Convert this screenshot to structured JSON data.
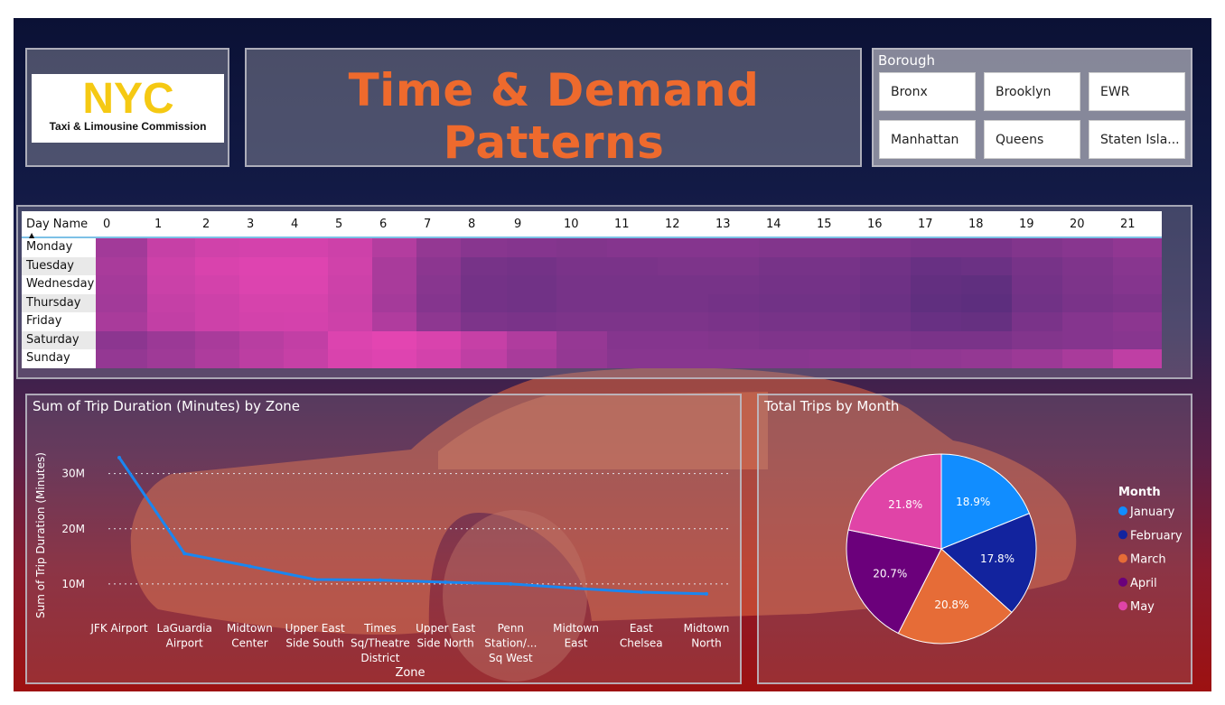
{
  "header": {
    "logo_mark": "NYC",
    "logo_text": "Taxi & Limousine Commission",
    "title": "Time & Demand Patterns"
  },
  "borough": {
    "title": "Borough",
    "options": [
      "Bronx",
      "Brooklyn",
      "EWR",
      "Manhattan",
      "Queens",
      "Staten Isla..."
    ]
  },
  "colors": {
    "title_orange": "#ee6a2d",
    "heat_low": "#5a2e7d",
    "heat_high": "#ea46b4",
    "line_blue": "#1a86f0",
    "january": "#118dff",
    "february": "#12239e",
    "march": "#e66c37",
    "april": "#6b007b",
    "may": "#e044a7"
  },
  "heatmap": {
    "row_header": "Day Name",
    "hours": [
      "0",
      "1",
      "2",
      "3",
      "4",
      "5",
      "6",
      "7",
      "8",
      "9",
      "10",
      "11",
      "12",
      "13",
      "14",
      "15",
      "16",
      "17",
      "18",
      "19",
      "20",
      "21"
    ],
    "days": [
      "Monday",
      "Tuesday",
      "Wednesday",
      "Thursday",
      "Friday",
      "Saturday",
      "Sunday"
    ],
    "intensity_note_scale": [
      0,
      1
    ],
    "values": [
      [
        0.5,
        0.75,
        0.82,
        0.85,
        0.85,
        0.8,
        0.62,
        0.4,
        0.32,
        0.3,
        0.28,
        0.3,
        0.3,
        0.3,
        0.28,
        0.28,
        0.26,
        0.22,
        0.22,
        0.28,
        0.32,
        0.38
      ],
      [
        0.55,
        0.8,
        0.88,
        0.92,
        0.92,
        0.82,
        0.55,
        0.35,
        0.2,
        0.18,
        0.22,
        0.22,
        0.24,
        0.24,
        0.2,
        0.2,
        0.16,
        0.1,
        0.12,
        0.2,
        0.26,
        0.32
      ],
      [
        0.52,
        0.78,
        0.84,
        0.9,
        0.9,
        0.8,
        0.55,
        0.32,
        0.18,
        0.16,
        0.2,
        0.2,
        0.2,
        0.2,
        0.18,
        0.18,
        0.14,
        0.06,
        0.04,
        0.18,
        0.24,
        0.3
      ],
      [
        0.5,
        0.74,
        0.8,
        0.86,
        0.86,
        0.78,
        0.52,
        0.3,
        0.18,
        0.16,
        0.2,
        0.2,
        0.2,
        0.18,
        0.16,
        0.16,
        0.12,
        0.04,
        0.02,
        0.16,
        0.22,
        0.26
      ],
      [
        0.55,
        0.72,
        0.8,
        0.84,
        0.85,
        0.8,
        0.6,
        0.36,
        0.24,
        0.22,
        0.24,
        0.24,
        0.24,
        0.22,
        0.2,
        0.2,
        0.16,
        0.1,
        0.08,
        0.22,
        0.3,
        0.35
      ],
      [
        0.35,
        0.45,
        0.55,
        0.65,
        0.72,
        0.9,
        0.95,
        0.88,
        0.75,
        0.6,
        0.42,
        0.3,
        0.3,
        0.28,
        0.26,
        0.26,
        0.24,
        0.22,
        0.22,
        0.28,
        0.3,
        0.32
      ],
      [
        0.4,
        0.48,
        0.58,
        0.68,
        0.75,
        0.88,
        0.92,
        0.84,
        0.7,
        0.55,
        0.4,
        0.32,
        0.32,
        0.32,
        0.32,
        0.34,
        0.36,
        0.38,
        0.4,
        0.46,
        0.55,
        0.7
      ]
    ]
  },
  "chart_data": [
    {
      "type": "line",
      "title": "Sum of Trip Duration (Minutes) by Zone",
      "xlabel": "Zone",
      "ylabel": "Sum of Trip Duration (Minutes)",
      "categories": [
        "JFK Airport",
        "LaGuardia Airport",
        "Midtown Center",
        "Upper East Side South",
        "Times Sq/Theatre District",
        "Upper East Side North",
        "Penn Station/... Sq West",
        "Midtown East",
        "East Chelsea",
        "Midtown North"
      ],
      "category_lines": [
        [
          "JFK Airport"
        ],
        [
          "LaGuardia",
          "Airport"
        ],
        [
          "Midtown",
          "Center"
        ],
        [
          "Upper East",
          "Side South"
        ],
        [
          "Times",
          "Sq/Theatre",
          "District"
        ],
        [
          "Upper East",
          "Side North"
        ],
        [
          "Penn",
          "Station/...",
          "Sq West"
        ],
        [
          "Midtown",
          "East"
        ],
        [
          "East",
          "Chelsea"
        ],
        [
          "Midtown",
          "North"
        ]
      ],
      "values": [
        32900000,
        15500000,
        13200000,
        10800000,
        10700000,
        10300000,
        10000000,
        9200000,
        8500000,
        8200000
      ],
      "yticks": [
        10000000,
        20000000,
        30000000
      ],
      "ytick_labels": [
        "10M",
        "20M",
        "30M"
      ],
      "ylim": [
        0,
        36000000
      ],
      "grid": true
    },
    {
      "type": "pie",
      "title": "Total Trips by Month",
      "legend_title": "Month",
      "legend_position": "right",
      "labels": [
        "January",
        "February",
        "March",
        "April",
        "May"
      ],
      "values": [
        18.9,
        17.8,
        20.8,
        20.7,
        21.8
      ],
      "value_labels": [
        "18.9%",
        "17.8%",
        "20.8%",
        "20.7%",
        "21.8%"
      ]
    }
  ]
}
